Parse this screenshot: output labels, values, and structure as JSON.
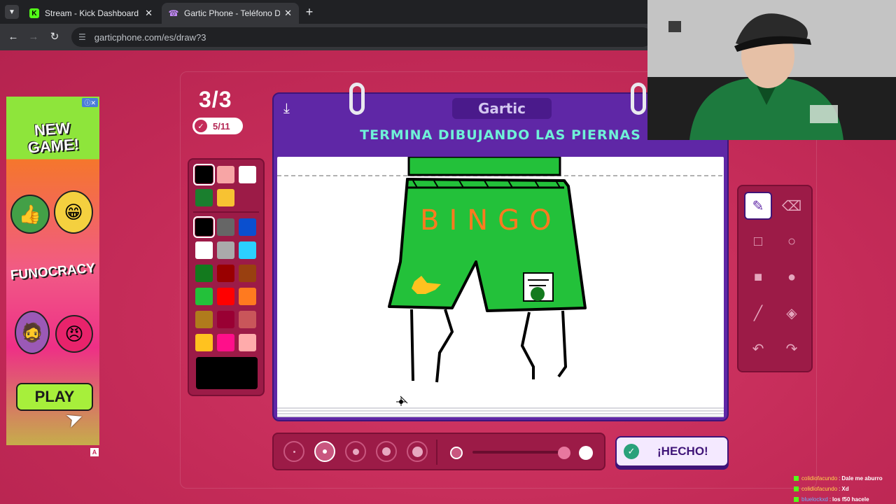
{
  "browser": {
    "tabs": [
      {
        "title": "Stream - Kick Dashboard",
        "favicon": "kick-icon",
        "active": false
      },
      {
        "title": "Gartic Phone - Teléfono Descon",
        "favicon": "phone-icon",
        "active": true
      }
    ],
    "url": "garticphone.com/es/draw?3"
  },
  "ad": {
    "headline": "NEW GAME!",
    "brand": "FUNOCRACY",
    "cta": "PLAY",
    "badge": "A"
  },
  "game": {
    "round": "3/3",
    "done_count": "5/11",
    "logo": "Gartic",
    "instruction": "TERMINA DIBUJANDO LAS PIERNAS",
    "canvas_text": "BINGO",
    "done_button": "¡HECHO!",
    "current_color": "#000000",
    "palette_recent": [
      "#000000",
      "#f7a5a5",
      "#ffffff",
      "#1a7f2e",
      "#f7c232"
    ],
    "palette": [
      "#000000",
      "#666666",
      "#0a4fcf",
      "#ffffff",
      "#aaaaaa",
      "#2bd0ff",
      "#137a1e",
      "#990000",
      "#994010",
      "#23c13a",
      "#ff0000",
      "#ff7a1f",
      "#b07b1c",
      "#990033",
      "#c9565a",
      "#ffc21f",
      "#ff0f8a",
      "#ffabab"
    ],
    "tools": [
      "pencil-icon",
      "eraser-icon",
      "rectangle-outline-icon",
      "circle-outline-icon",
      "rectangle-fill-icon",
      "circle-fill-icon",
      "line-icon",
      "fill-bucket-icon",
      "undo-icon",
      "redo-icon"
    ],
    "brush_sizes": 5,
    "selected_brush": 2
  },
  "chat": [
    {
      "user": "colidiofacundo",
      "sep": ":",
      "msg": "Dale me aburro"
    },
    {
      "user": "colidiofacundo",
      "sep": ":",
      "msg": "Xd"
    },
    {
      "user": "bluelockxd",
      "sep": ":",
      "msg": "los f50 hacele"
    }
  ]
}
